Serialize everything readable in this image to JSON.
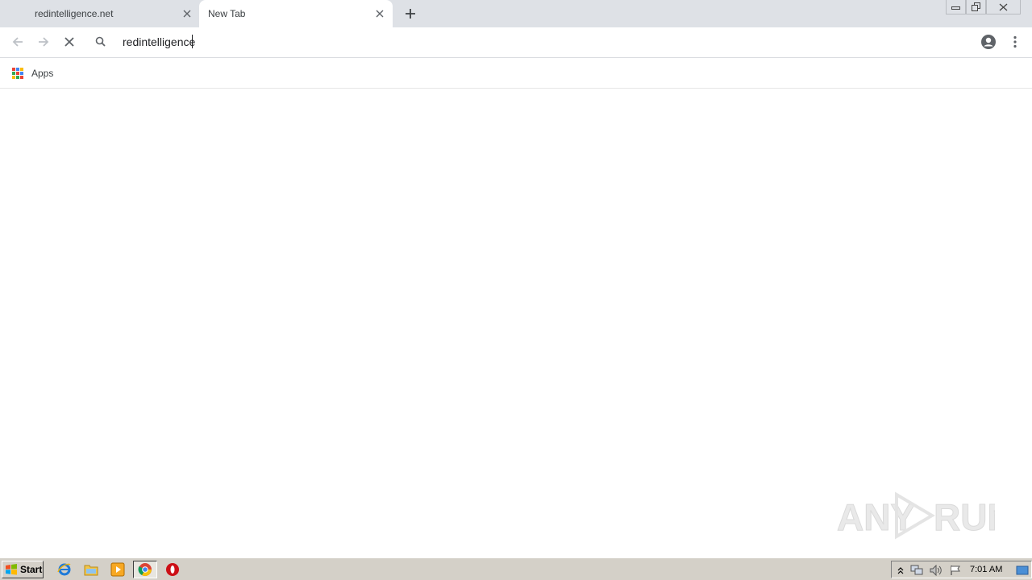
{
  "browser": {
    "tabs": [
      {
        "title": "redintelligence.net",
        "active": false
      },
      {
        "title": "New Tab",
        "active": true
      }
    ],
    "omnibox": {
      "value": "redintelligence"
    },
    "bookmarks": [
      {
        "label": "Apps",
        "icon": "apps-grid-icon"
      }
    ],
    "colors": {
      "tabstrip": "#dee1e6",
      "active_tab": "#ffffff",
      "text": "#3c4043"
    }
  },
  "watermark": {
    "text": "ANY RUN"
  },
  "taskbar": {
    "start_label": "Start",
    "clock": "7:01 AM",
    "pinned": [
      "internet-explorer-icon",
      "file-explorer-icon",
      "media-player-icon",
      "chrome-icon",
      "opera-icon"
    ]
  }
}
